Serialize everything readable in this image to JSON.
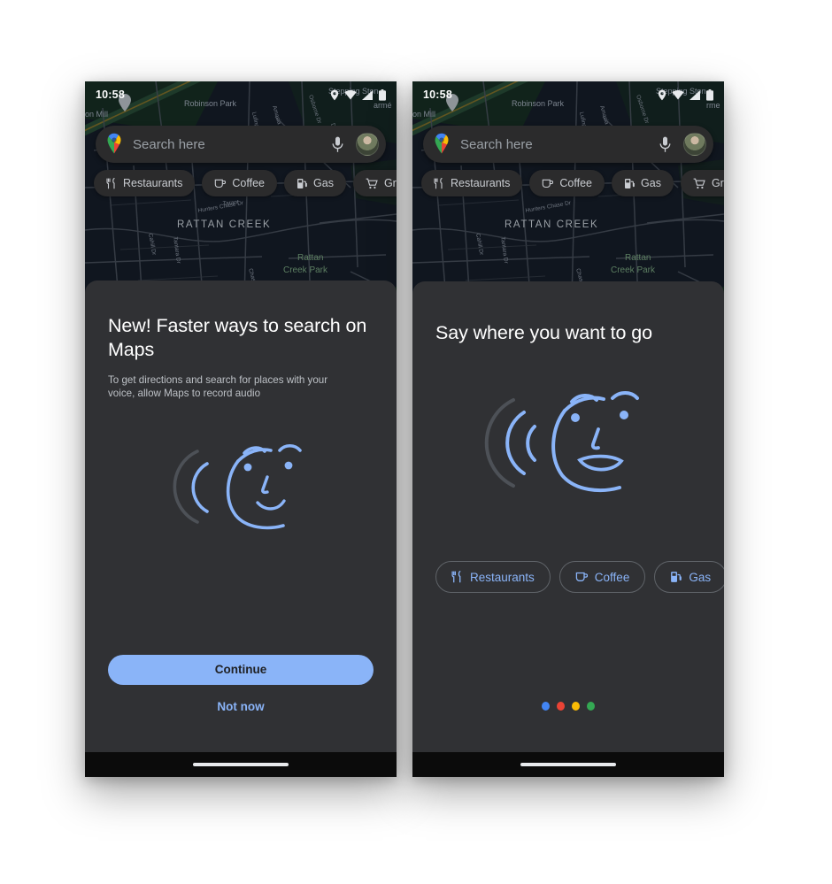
{
  "screens": [
    {
      "id": "permission-prompt",
      "status_bar": {
        "time": "10:58",
        "icons": [
          "location-pin-icon",
          "wifi-icon",
          "signal-icon",
          "battery-icon"
        ]
      },
      "search": {
        "logo": "google-maps-pin-icon",
        "placeholder": "Search here",
        "mic_icon": "microphone-icon",
        "avatar": "account-avatar"
      },
      "map": {
        "labels": [
          "Robinson Park",
          "Stepping Ston",
          "RATTAN CREEK",
          "Rattan Creek Park",
          "Hunters Chase Dr",
          "Cahill Dr",
          "Tantara Dr",
          "Chase Dr",
          "Lufing Ln",
          "Amasia Dr",
          "Osborne Dr",
          "on Mill",
          "armé"
        ],
        "layers_button_icon": "layers-icon"
      },
      "map_chips": [
        {
          "label": "Restaurants",
          "icon": "restaurant-icon"
        },
        {
          "label": "Coffee",
          "icon": "coffee-icon"
        },
        {
          "label": "Gas",
          "icon": "gas-icon"
        },
        {
          "label": "Grocer",
          "icon": "grocery-cart-icon"
        }
      ],
      "sheet": {
        "title": "New! Faster ways to search on Maps",
        "subtitle": "To get directions and search for places with your voice, allow Maps to record audio",
        "illustration": "voice-face-illustration",
        "primary_button": "Continue",
        "secondary_button": "Not now"
      }
    },
    {
      "id": "voice-onboarding",
      "status_bar": {
        "time": "10:58",
        "icons": [
          "location-pin-icon",
          "wifi-icon",
          "signal-icon",
          "battery-icon"
        ]
      },
      "search": {
        "logo": "google-maps-pin-icon",
        "placeholder": "Search here",
        "mic_icon": "microphone-icon",
        "avatar": "account-avatar"
      },
      "map": {
        "labels": [
          "Robinson Park",
          "Stepping Ston",
          "RATTAN CREEK",
          "Rattan Creek Park",
          "Hunters Chase Dr",
          "Cahill Dr",
          "Tantara Dr",
          "Chase Dr",
          "Lufing Ln",
          "Amasia Dr",
          "Osborne Dr",
          "on Mill",
          "rme"
        ],
        "layers_button_icon": "layers-icon"
      },
      "map_chips": [
        {
          "label": "Restaurants",
          "icon": "restaurant-icon"
        },
        {
          "label": "Coffee",
          "icon": "coffee-icon"
        },
        {
          "label": "Gas",
          "icon": "gas-icon"
        },
        {
          "label": "Grocer",
          "icon": "grocery-cart-icon"
        }
      ],
      "sheet": {
        "title": "Say where you want to go",
        "illustration": "voice-face-speaking-illustration",
        "suggestion_chips": [
          {
            "label": "Restaurants",
            "icon": "restaurant-icon"
          },
          {
            "label": "Coffee",
            "icon": "coffee-icon"
          },
          {
            "label": "Gas",
            "icon": "gas-icon"
          },
          {
            "label": "",
            "icon": "grocery-cart-icon"
          }
        ],
        "page_dots": [
          "#4285f4",
          "#ea4335",
          "#fbbc05",
          "#34a853"
        ],
        "active_dot_index": 0
      }
    }
  ],
  "theme": {
    "accent_blue": "#8ab4f8",
    "sheet_background": "#303134",
    "map_background": "#10161f",
    "page_background": "#ffffff",
    "text_primary": "#ffffff",
    "text_secondary": "#bdc1c6",
    "chip_background": "#2b2b2c"
  }
}
